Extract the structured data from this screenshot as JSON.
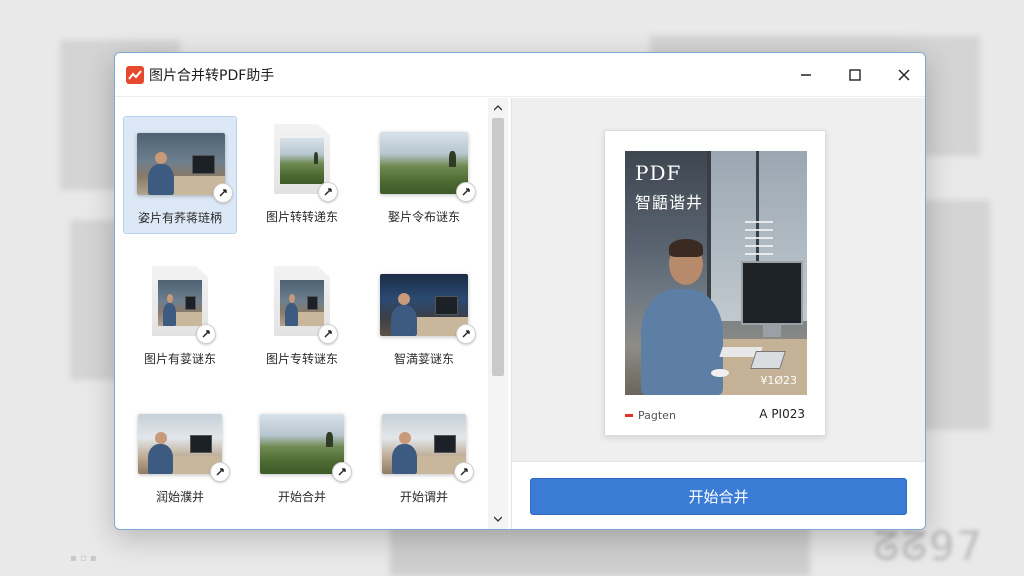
{
  "window": {
    "title": "图片合并转PDF助手"
  },
  "thumbnails": [
    {
      "label": "姿片有荞蒋琏柄",
      "kind": "photo",
      "scene": "office",
      "selected": true
    },
    {
      "label": "图片转转递东",
      "kind": "doc",
      "scene": "land",
      "selected": false
    },
    {
      "label": "娶片令布谜东",
      "kind": "photo",
      "scene": "land",
      "selected": false
    },
    {
      "label": "图片有荽谜东",
      "kind": "doc",
      "scene": "office",
      "selected": false
    },
    {
      "label": "图片专转谜东",
      "kind": "doc",
      "scene": "office",
      "selected": false
    },
    {
      "label": "智満荽谜东",
      "kind": "photo",
      "scene": "conf",
      "selected": false
    },
    {
      "label": "润始濮并",
      "kind": "photo",
      "scene": "office2",
      "selected": false
    },
    {
      "label": "开始合并",
      "kind": "photo",
      "scene": "land",
      "selected": false
    },
    {
      "label": "开始谓并",
      "kind": "photo",
      "scene": "office2",
      "selected": false
    }
  ],
  "preview": {
    "title": "PDF",
    "subtitle": "智鼯谐井",
    "image_code": "¥1Ø23",
    "footer_left": "Pagten",
    "footer_right": "A PI023"
  },
  "actions": {
    "merge_label": "开始合并"
  },
  "background": {
    "blur_text": "ᘔᘔ97"
  },
  "colors": {
    "accent": "#3a7bd5",
    "logo": "#e64a2e",
    "selection": "#dde8f6"
  }
}
